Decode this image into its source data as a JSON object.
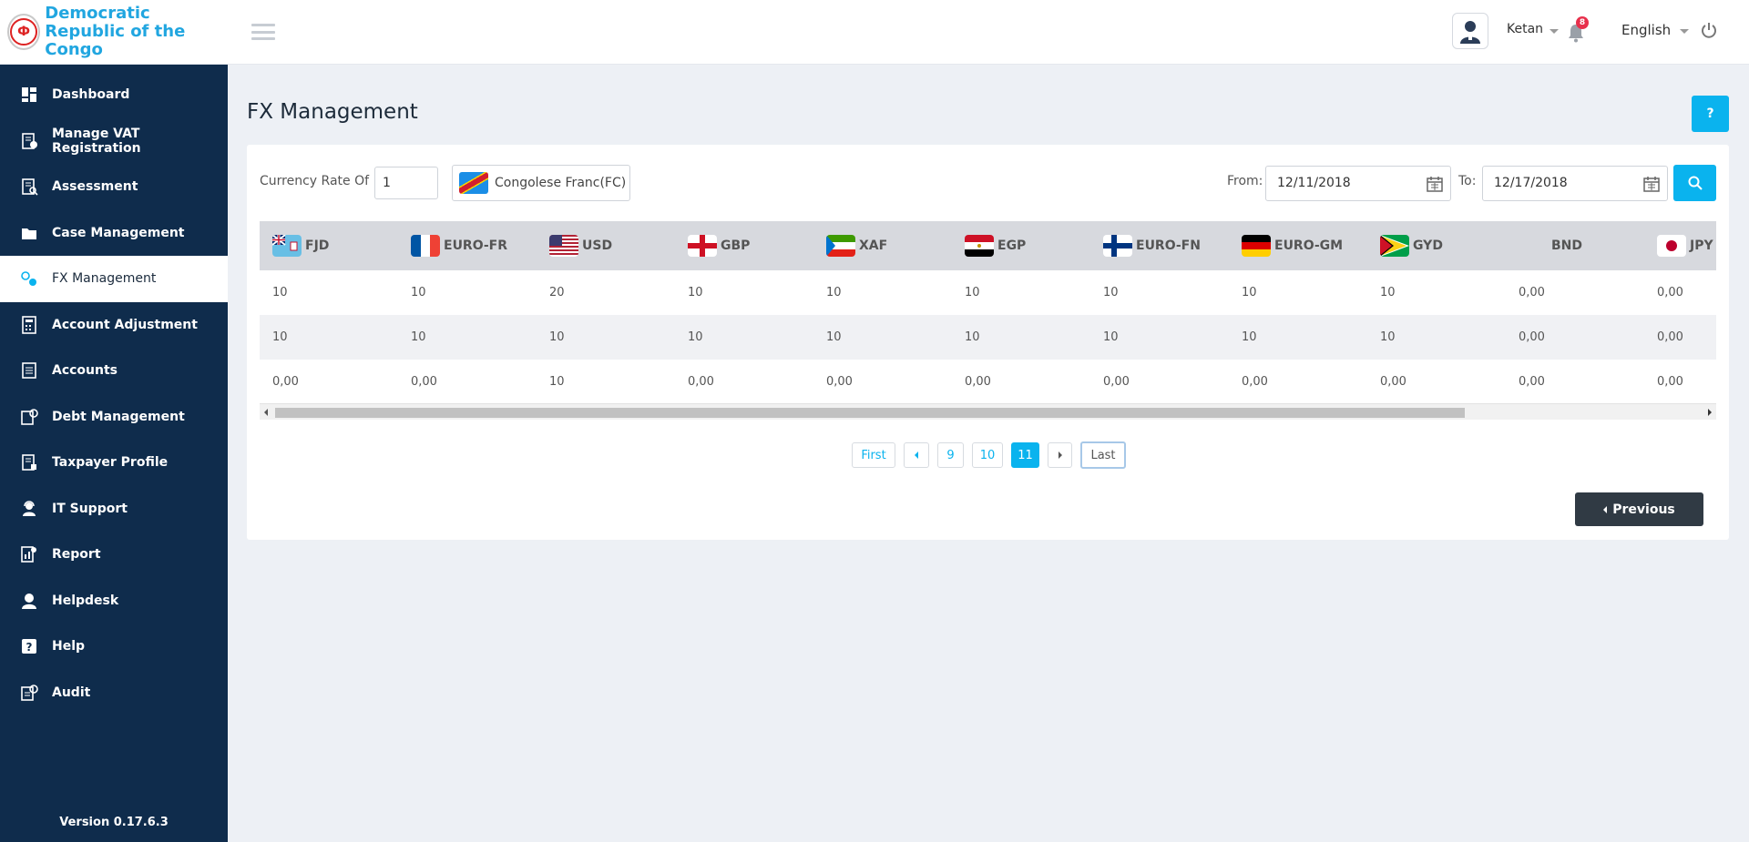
{
  "brand": {
    "name_line1": "Democratic",
    "name_line2": "Republic of the Congo",
    "logo_letter": "Ф"
  },
  "sidebar": {
    "items": [
      {
        "label": "Dashboard",
        "icon": "dashboard-icon"
      },
      {
        "label": "Manage VAT Registration",
        "icon": "vat-icon"
      },
      {
        "label": "Assessment",
        "icon": "assessment-icon"
      },
      {
        "label": "Case Management",
        "icon": "folder-icon"
      },
      {
        "label": "FX Management",
        "icon": "fx-icon",
        "active": true
      },
      {
        "label": "Account Adjustment",
        "icon": "calculator-icon"
      },
      {
        "label": "Accounts",
        "icon": "accounts-icon"
      },
      {
        "label": "Debt Management",
        "icon": "debt-icon"
      },
      {
        "label": "Taxpayer Profile",
        "icon": "profile-icon"
      },
      {
        "label": "IT Support",
        "icon": "support-icon"
      },
      {
        "label": "Report",
        "icon": "report-icon"
      },
      {
        "label": "Helpdesk",
        "icon": "helpdesk-icon"
      },
      {
        "label": "Help",
        "icon": "help-icon"
      },
      {
        "label": "Audit",
        "icon": "audit-icon"
      }
    ],
    "version": "Version 0.17.6.3"
  },
  "header": {
    "user_name": "Ketan",
    "notification_count": "8",
    "language": "English"
  },
  "page": {
    "title": "FX Management",
    "help_label": "?"
  },
  "filters": {
    "currency_rate_label": "Currency Rate Of",
    "rate_value": "1",
    "currency": "Congolese Franc(FC)",
    "from_label": "From:",
    "from_date": "12/11/2018",
    "to_label": "To:",
    "to_date": "12/17/2018"
  },
  "table": {
    "columns": [
      {
        "code": "FJD",
        "flag": "fiji"
      },
      {
        "code": "EURO-FR",
        "flag": "france"
      },
      {
        "code": "USD",
        "flag": "usa"
      },
      {
        "code": "GBP",
        "flag": "england"
      },
      {
        "code": "XAF",
        "flag": "equatorial-guinea"
      },
      {
        "code": "EGP",
        "flag": "egypt"
      },
      {
        "code": "EURO-FN",
        "flag": "finland"
      },
      {
        "code": "EURO-GM",
        "flag": "germany"
      },
      {
        "code": "GYD",
        "flag": "guyana"
      },
      {
        "code": "BND",
        "flag": ""
      },
      {
        "code": "JPY",
        "flag": "japan"
      }
    ],
    "rows": [
      [
        "10",
        "10",
        "20",
        "10",
        "10",
        "10",
        "10",
        "10",
        "10",
        "0,00",
        "0,00"
      ],
      [
        "10",
        "10",
        "10",
        "10",
        "10",
        "10",
        "10",
        "10",
        "10",
        "0,00",
        "0,00"
      ],
      [
        "0,00",
        "0,00",
        "10",
        "0,00",
        "0,00",
        "0,00",
        "0,00",
        "0,00",
        "0,00",
        "0,00",
        "0,00"
      ]
    ]
  },
  "pagination": {
    "first": "First",
    "pages": [
      "9",
      "10",
      "11"
    ],
    "current": "11",
    "last": "Last"
  },
  "actions": {
    "previous": "Previous"
  },
  "colors": {
    "sidebar": "#0f2c4c",
    "accent": "#0ab3ee",
    "brand_text": "#21a6e0",
    "dark_button": "#303a44"
  }
}
